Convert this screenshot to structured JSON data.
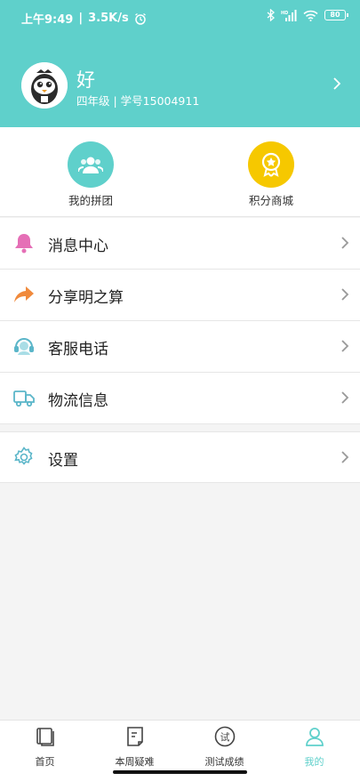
{
  "status": {
    "time": "上午9:49",
    "network_speed": "3.5K/s",
    "battery": "80",
    "network_type": "HD"
  },
  "profile": {
    "name": "好",
    "meta": "四年级 | 学号15004911"
  },
  "quick_actions": [
    {
      "label": "我的拼团",
      "icon": "group-icon",
      "color": "#5fd0cb"
    },
    {
      "label": "积分商城",
      "icon": "star-award-icon",
      "color": "#f6c800"
    }
  ],
  "menu": [
    {
      "label": "消息中心",
      "icon": "bell-icon"
    },
    {
      "label": "分享明之算",
      "icon": "share-arrow-icon"
    },
    {
      "label": "客服电话",
      "icon": "headset-icon"
    },
    {
      "label": "物流信息",
      "icon": "truck-icon"
    }
  ],
  "settings": {
    "label": "设置",
    "icon": "gear-icon"
  },
  "tabs": [
    {
      "label": "首页",
      "icon": "book-icon"
    },
    {
      "label": "本周疑难",
      "icon": "note-icon"
    },
    {
      "label": "测试成绩",
      "icon": "test-icon",
      "badge": "试"
    },
    {
      "label": "我的",
      "icon": "person-icon"
    }
  ],
  "colors": {
    "accent": "#5fd0cb",
    "gold": "#f6c800",
    "bell": "#e56fb6",
    "share": "#f08a3c"
  }
}
